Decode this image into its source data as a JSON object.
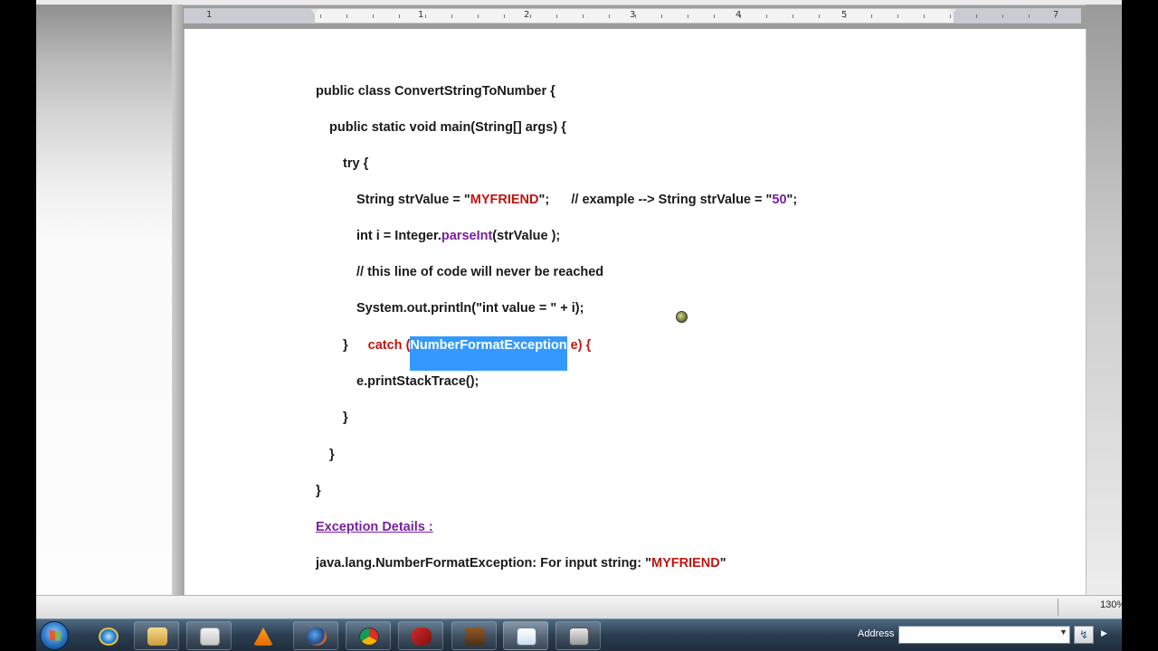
{
  "code": {
    "l1": "public class ConvertStringToNumber {",
    "l2": "public static void main(String[] args) {",
    "l3": "try {",
    "l4a": "String strValue = \"",
    "l4b": "MYFRIEND",
    "l4c": "\";      // example --> String strValue = \"",
    "l4d": "50",
    "l4e": "\";",
    "l5a": "int i = Integer.",
    "l5b": "parseInt",
    "l5c": "(strValue );",
    "l6": "// this line of code will never be reached",
    "l7": "System.out.println(\"int value = \" + i);",
    "l8a": "}",
    "l8b": "catch (",
    "l8c": "NumberFormatException",
    "l8d": " e) {",
    "l9": "e.printStackTrace();",
    "l10": "}",
    "l11": "}",
    "l12": "}"
  },
  "exception": {
    "heading": "Exception Details :",
    "msg_a": "java.lang.NumberFormatException: For input string: \"",
    "msg_b": "MYFRIEND",
    "msg_c": "\""
  },
  "ruler": {
    "numbers": [
      "1",
      "1",
      "2",
      "3",
      "4",
      "5",
      "7"
    ]
  },
  "status": {
    "zoom": "130%"
  },
  "taskbar": {
    "address_label": "Address",
    "address_value": "",
    "go_symbol": "↯"
  },
  "colors": {
    "keyword_red": "#c0150f",
    "method_purple": "#7a1fa2",
    "selection": "#3399ff"
  }
}
